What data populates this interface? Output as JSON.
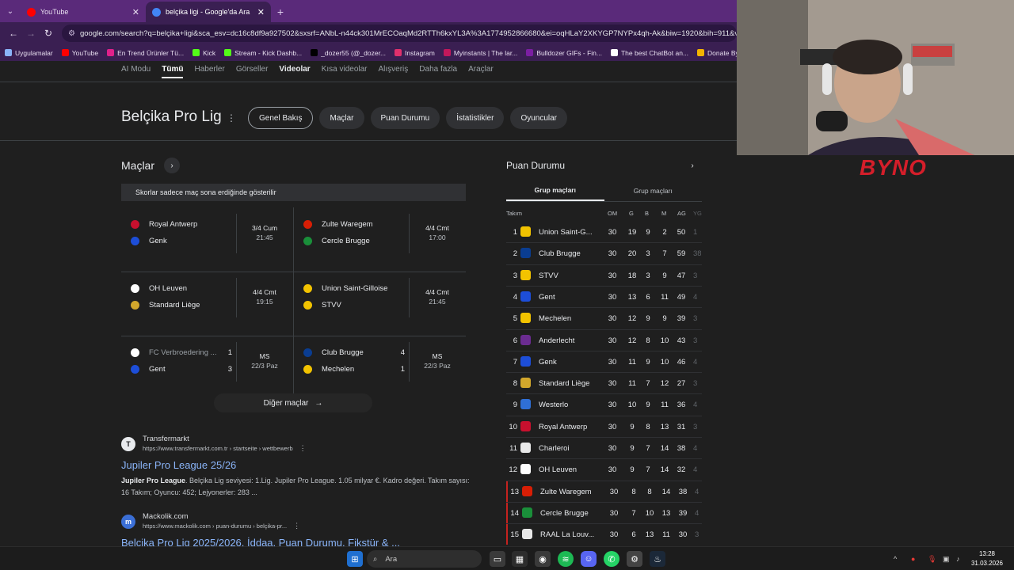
{
  "browser": {
    "tabs": [
      {
        "label": "YouTube",
        "active": false,
        "color": "#ff0000"
      },
      {
        "label": "belçika ligi - Google'da Ara",
        "active": true,
        "color": "#4285f4"
      }
    ],
    "url": "google.com/search?q=belçika+ligi&sca_esv=dc16c8df9a927502&sxsrf=ANbL-n44ck301MrECOaqMd2RTTh6kxYL3A%3A1774952866680&ei=oqHLaY2XKYGP7NYPx4qh-Ak&biw=1920&bih=911&ved=0",
    "bookmarks": [
      {
        "label": "Uygulamalar",
        "color": "#8ab4f8"
      },
      {
        "label": "YouTube",
        "color": "#ff0000"
      },
      {
        "label": "En Trend Ürünler Tü...",
        "color": "#e0218a"
      },
      {
        "label": "Kick",
        "color": "#53fc18"
      },
      {
        "label": "Stream - Kick Dashb...",
        "color": "#53fc18"
      },
      {
        "label": "_dozer55 (@_dozer...",
        "color": "#000000"
      },
      {
        "label": "Instagram",
        "color": "#e1306c"
      },
      {
        "label": "Myinstants | The lar...",
        "color": "#c2185b"
      },
      {
        "label": "Bulldozer GIFs - Fin...",
        "color": "#7b1fa2"
      },
      {
        "label": "The best ChatBot an...",
        "color": "#ffffff"
      },
      {
        "label": "Donate ByNoGam...",
        "color": "#f4b400"
      }
    ]
  },
  "search_nav": [
    "AI Modu",
    "Tümü",
    "Haberler",
    "Görseller",
    "Videolar",
    "Kısa videolar",
    "Alışveriş",
    "Daha fazla",
    "Araçlar"
  ],
  "knowledge_panel": {
    "title": "Belçika Pro Lig",
    "chips": [
      "Genel Bakış",
      "Maçlar",
      "Puan Durumu",
      "İstatistikler",
      "Oyuncular"
    ]
  },
  "matches": {
    "title": "Maçlar",
    "notice": "Skorlar sadece maç sona erdiğinde gösterilir",
    "items": [
      {
        "home": "Royal Antwerp",
        "away": "Genk",
        "date": "3/4 Cum",
        "time": "21:45",
        "home_score": "",
        "away_score": "",
        "home_color": "#c8102e",
        "away_color": "#1d4ed8"
      },
      {
        "home": "Zulte Waregem",
        "away": "Cercle Brugge",
        "date": "4/4 Cmt",
        "time": "17:00",
        "home_score": "",
        "away_score": "",
        "home_color": "#d81e05",
        "away_color": "#1a8f3a"
      },
      {
        "home": "OH Leuven",
        "away": "Standard Liège",
        "date": "4/4 Cmt",
        "time": "19:15",
        "home_score": "",
        "away_score": "",
        "home_color": "#ffffff",
        "away_color": "#d2a72c"
      },
      {
        "home": "Union Saint-Gilloise",
        "away": "STVV",
        "date": "4/4 Cmt",
        "time": "21:45",
        "home_score": "",
        "away_score": "",
        "home_color": "#f2c300",
        "away_color": "#f2c300"
      },
      {
        "home": "FC Verbroedering ...",
        "away": "Gent",
        "date": "MS",
        "time": "22/3 Paz",
        "home_score": "1",
        "away_score": "3",
        "home_color": "#ffffff",
        "away_color": "#1d4ed8"
      },
      {
        "home": "Club Brugge",
        "away": "Mechelen",
        "date": "MS",
        "time": "22/3 Paz",
        "home_score": "4",
        "away_score": "1",
        "home_color": "#0a3d91",
        "away_color": "#f2c300"
      }
    ],
    "more_label": "Diğer maçlar"
  },
  "results": [
    {
      "name": "Transfermarkt",
      "icon": "T",
      "url": "https://www.transfermarkt.com.tr › startseite › wettbewerb",
      "title": "Jupiler Pro League 25/26",
      "snippet_bold": "Jupiler Pro League",
      "snippet": ". Belçika Lig seviyesi: 1.Lig. Jupiler Pro League. 1.05 milyar €. Kadro değeri. Takım sayısı: 16 Takım; Oyuncu: 452; Lejyonerler: 283 ..."
    },
    {
      "name": "Mackolik.com",
      "icon": "m",
      "url": "https://www.mackolik.com › puan-durumu › belçika-pr...",
      "title": "Belçika Pro Lig 2025/2026, İddaa, Puan Durumu, Fikstür & ...",
      "snippet_bold": "",
      "snippet": ""
    }
  ],
  "standings": {
    "title": "Puan Durumu",
    "tabs": [
      "Grup maçları",
      "Grup maçları"
    ],
    "headers": [
      "Takım",
      "OM",
      "G",
      "B",
      "M",
      "AG",
      "YG"
    ],
    "rows": [
      {
        "pos": "1",
        "team": "Union Saint-G...",
        "om": "30",
        "g": "19",
        "b": "9",
        "m": "2",
        "ag": "50",
        "yg": "1",
        "color": "#f2c300"
      },
      {
        "pos": "2",
        "team": "Club Brugge",
        "om": "30",
        "g": "20",
        "b": "3",
        "m": "7",
        "ag": "59",
        "yg": "38",
        "color": "#0a3d91"
      },
      {
        "pos": "3",
        "team": "STVV",
        "om": "30",
        "g": "18",
        "b": "3",
        "m": "9",
        "ag": "47",
        "yg": "3",
        "color": "#f2c300"
      },
      {
        "pos": "4",
        "team": "Gent",
        "om": "30",
        "g": "13",
        "b": "6",
        "m": "11",
        "ag": "49",
        "yg": "4",
        "color": "#1d4ed8"
      },
      {
        "pos": "5",
        "team": "Mechelen",
        "om": "30",
        "g": "12",
        "b": "9",
        "m": "9",
        "ag": "39",
        "yg": "3",
        "color": "#f2c300"
      },
      {
        "pos": "6",
        "team": "Anderlecht",
        "om": "30",
        "g": "12",
        "b": "8",
        "m": "10",
        "ag": "43",
        "yg": "3",
        "color": "#6b2c91"
      },
      {
        "pos": "7",
        "team": "Genk",
        "om": "30",
        "g": "11",
        "b": "9",
        "m": "10",
        "ag": "46",
        "yg": "4",
        "color": "#1d4ed8"
      },
      {
        "pos": "8",
        "team": "Standard Liège",
        "om": "30",
        "g": "11",
        "b": "7",
        "m": "12",
        "ag": "27",
        "yg": "3",
        "color": "#d2a72c"
      },
      {
        "pos": "9",
        "team": "Westerlo",
        "om": "30",
        "g": "10",
        "b": "9",
        "m": "11",
        "ag": "36",
        "yg": "4",
        "color": "#2f6fd6"
      },
      {
        "pos": "10",
        "team": "Royal Antwerp",
        "om": "30",
        "g": "9",
        "b": "8",
        "m": "13",
        "ag": "31",
        "yg": "3",
        "color": "#c8102e"
      },
      {
        "pos": "11",
        "team": "Charleroi",
        "om": "30",
        "g": "9",
        "b": "7",
        "m": "14",
        "ag": "38",
        "yg": "4",
        "color": "#e8e8e8"
      },
      {
        "pos": "12",
        "team": "OH Leuven",
        "om": "30",
        "g": "9",
        "b": "7",
        "m": "14",
        "ag": "32",
        "yg": "4",
        "color": "#ffffff"
      },
      {
        "pos": "13",
        "team": "Zulte Waregem",
        "om": "30",
        "g": "8",
        "b": "8",
        "m": "14",
        "ag": "38",
        "yg": "4",
        "color": "#d81e05"
      },
      {
        "pos": "14",
        "team": "Cercle Brugge",
        "om": "30",
        "g": "7",
        "b": "10",
        "m": "13",
        "ag": "39",
        "yg": "4",
        "color": "#1a8f3a"
      },
      {
        "pos": "15",
        "team": "RAAL La Louv...",
        "om": "30",
        "g": "6",
        "b": "13",
        "m": "11",
        "ag": "30",
        "yg": "3",
        "color": "#e8e8e8"
      }
    ]
  },
  "overlay": {
    "brand": "BYNO"
  },
  "taskbar": {
    "search_placeholder": "Ara",
    "time": "13:28",
    "date": "31.03.2026"
  }
}
